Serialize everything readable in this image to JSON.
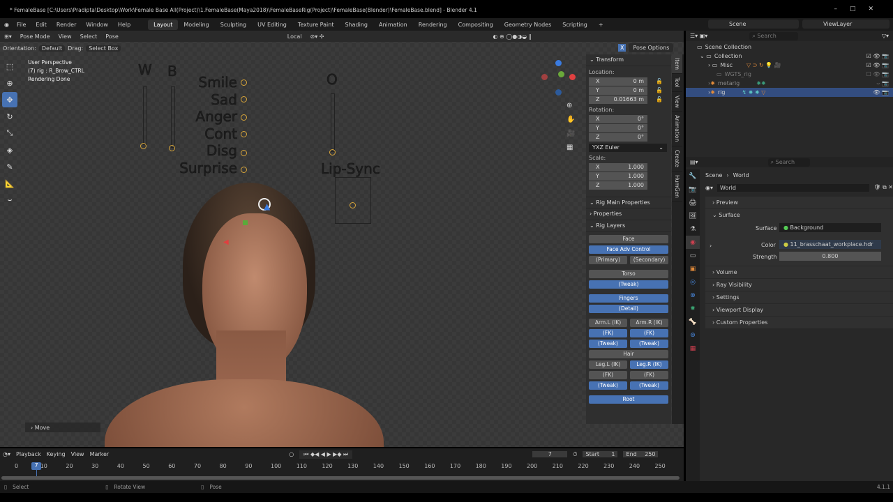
{
  "title": "* FemaleBase [C:\\Users\\Pradipta\\Desktop\\Work\\Female Base All(Project)\\1.FemaleBase(Maya2018)\\FemaleBaseRig(Project)\\FemaleBase(Blender)\\FemaleBase.blend] - Blender 4.1",
  "menu": [
    "File",
    "Edit",
    "Render",
    "Window",
    "Help"
  ],
  "workspaces": [
    "Layout",
    "Modeling",
    "Sculpting",
    "UV Editing",
    "Texture Paint",
    "Shading",
    "Animation",
    "Rendering",
    "Compositing",
    "Geometry Nodes",
    "Scripting"
  ],
  "scene": "Scene",
  "view_layer": "ViewLayer",
  "viewport": {
    "mode": "Pose Mode",
    "menus": [
      "View",
      "Select",
      "Pose"
    ],
    "pivot": "Local",
    "orientation_label": "Orientation:",
    "orientation": "Default",
    "drag_label": "Drag:",
    "drag": "Select Box",
    "pose_options": "Pose Options",
    "overlay": [
      "User Perspective",
      "(7) rig : R_Brow_CTRL",
      "Rendering Done"
    ],
    "shape_labels": [
      "W",
      "B",
      "Smile",
      "Sad",
      "Anger",
      "Cont",
      "Disg",
      "Surprise",
      "O",
      "Lip-Sync"
    ],
    "last_op": "Move"
  },
  "npanel": {
    "transform": "Transform",
    "location": "Location:",
    "rotation": "Rotation:",
    "scale": "Scale:",
    "axes": [
      "X",
      "Y",
      "Z"
    ],
    "loc": [
      "0 m",
      "0 m",
      "0.01663 m"
    ],
    "rot": [
      "0°",
      "0°",
      "0°"
    ],
    "rot_mode": "YXZ Euler",
    "scl": [
      "1.000",
      "1.000",
      "1.000"
    ],
    "sections": [
      "Rig Main Properties",
      "Properties",
      "Rig Layers"
    ],
    "tabs": [
      "Item",
      "Tool",
      "View",
      "Animation",
      "Create",
      "HumGen"
    ],
    "layers": {
      "face": "Face",
      "face_adv": "Face Adv Control",
      "primary": "(Primary)",
      "secondary": "(Secondary)",
      "torso": "Torso",
      "torso_tweak": "(Tweak)",
      "fingers": "Fingers",
      "detail": "(Detail)",
      "arm_l": "Arm.L (IK)",
      "arm_r": "Arm.R (IK)",
      "fk": "(FK)",
      "tweak": "(Tweak)",
      "hair": "Hair",
      "leg_l": "Leg.L (IK)",
      "leg_r": "Leg.R (IK)",
      "root": "Root"
    }
  },
  "outliner": {
    "search": "Search",
    "items": [
      "Scene Collection",
      "Collection",
      "Misc",
      "WGTS_rig",
      "metarig",
      "rig"
    ]
  },
  "properties": {
    "search": "Search",
    "breadcrumb": [
      "Scene",
      "World"
    ],
    "world": "World",
    "sections": [
      "Preview",
      "Surface",
      "Volume",
      "Ray Visibility",
      "Settings",
      "Viewport Display",
      "Custom Properties"
    ],
    "surface_label": "Surface",
    "surface": "Background",
    "color_label": "Color",
    "color": "11_brasschaat_workplace.hdr",
    "strength_label": "Strength",
    "strength": "0.800"
  },
  "timeline": {
    "menus": [
      "Playback",
      "Keying",
      "View",
      "Marker"
    ],
    "frame": "7",
    "start_label": "Start",
    "start": "1",
    "end_label": "End",
    "end": "250",
    "ticks": [
      "0",
      "10",
      "20",
      "30",
      "40",
      "50",
      "60",
      "70",
      "80",
      "90",
      "100",
      "110",
      "120",
      "130",
      "140",
      "150",
      "160",
      "170",
      "180",
      "190",
      "200",
      "210",
      "220",
      "230",
      "240",
      "250"
    ]
  },
  "status": {
    "items": [
      "Select",
      "Rotate View",
      "Pose"
    ],
    "version": "4.1.1"
  }
}
